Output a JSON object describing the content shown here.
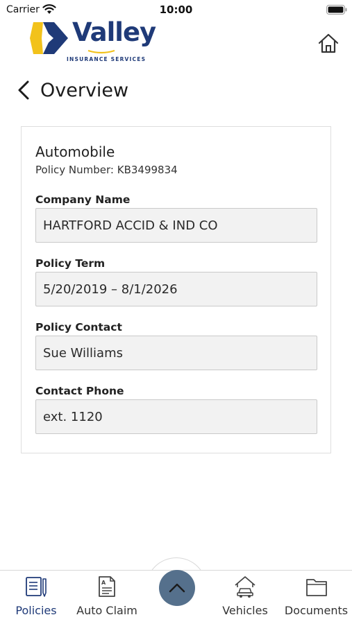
{
  "status_bar": {
    "carrier": "Carrier",
    "time": "10:00"
  },
  "brand": {
    "name": "Valley",
    "tagline": "INSURANCE SERVICES",
    "primary_color": "#1f3a78",
    "accent_color": "#f2c21b"
  },
  "header": {
    "back_label": "Overview",
    "home_icon": "home-icon"
  },
  "policy": {
    "type": "Automobile",
    "number_text": "Policy Number: KB3499834",
    "fields": [
      {
        "label": "Company Name",
        "value": "HARTFORD ACCID & IND CO"
      },
      {
        "label": "Policy Term",
        "value": "5/20/2019 – 8/1/2026"
      },
      {
        "label": "Policy Contact",
        "value": "Sue Williams"
      },
      {
        "label": "Contact Phone",
        "value": "ext. 1120"
      }
    ]
  },
  "tabs": [
    {
      "label": "Policies",
      "icon": "policies-icon",
      "active": true
    },
    {
      "label": "Auto Claim",
      "icon": "auto-claim-icon",
      "active": false
    },
    {
      "label": "Vehicles",
      "icon": "vehicles-icon",
      "active": false
    },
    {
      "label": "Documents",
      "icon": "documents-icon",
      "active": false
    }
  ],
  "center_button": {
    "icon": "chevron-up-icon",
    "color": "#55708c"
  }
}
